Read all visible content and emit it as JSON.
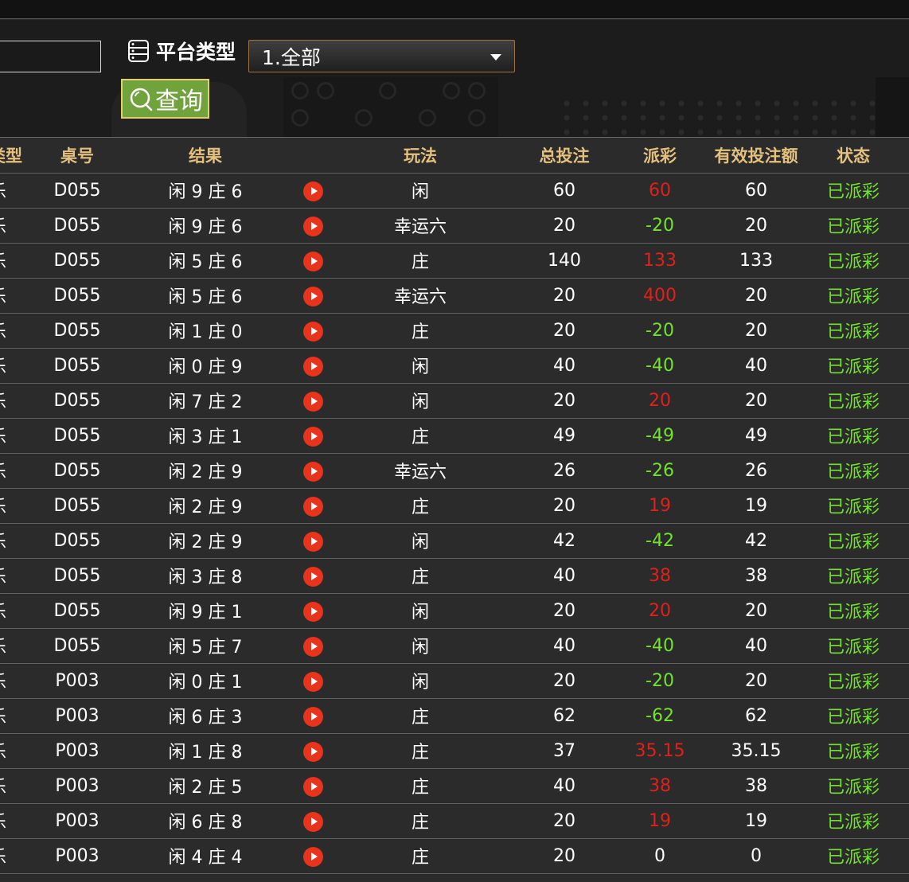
{
  "filter": {
    "platform_label": "平台类型",
    "platform_selected": "1.全部",
    "query_label": "查询"
  },
  "table": {
    "headers": {
      "type": "类型",
      "table_no": "桌号",
      "result": "结果",
      "play": "玩法",
      "total_bet": "总投注",
      "payout": "派彩",
      "valid_bet": "有效投注额",
      "status": "状态"
    },
    "rows": [
      {
        "type": "乐",
        "table_no": "D055",
        "result": "闲 9 庄 6",
        "play": "闲",
        "total_bet": "60",
        "payout": "60",
        "payout_color": "#e0201a",
        "valid_bet": "60",
        "status": "已派彩"
      },
      {
        "type": "乐",
        "table_no": "D055",
        "result": "闲 9 庄 6",
        "play": "幸运六",
        "total_bet": "20",
        "payout": "-20",
        "payout_color": "#72e32c",
        "valid_bet": "20",
        "status": "已派彩"
      },
      {
        "type": "乐",
        "table_no": "D055",
        "result": "闲 5 庄 6",
        "play": "庄",
        "total_bet": "140",
        "payout": "133",
        "payout_color": "#e0201a",
        "valid_bet": "133",
        "status": "已派彩"
      },
      {
        "type": "乐",
        "table_no": "D055",
        "result": "闲 5 庄 6",
        "play": "幸运六",
        "total_bet": "20",
        "payout": "400",
        "payout_color": "#e0201a",
        "valid_bet": "20",
        "status": "已派彩"
      },
      {
        "type": "乐",
        "table_no": "D055",
        "result": "闲 1 庄 0",
        "play": "庄",
        "total_bet": "20",
        "payout": "-20",
        "payout_color": "#72e32c",
        "valid_bet": "20",
        "status": "已派彩"
      },
      {
        "type": "乐",
        "table_no": "D055",
        "result": "闲 0 庄 9",
        "play": "闲",
        "total_bet": "40",
        "payout": "-40",
        "payout_color": "#72e32c",
        "valid_bet": "40",
        "status": "已派彩"
      },
      {
        "type": "乐",
        "table_no": "D055",
        "result": "闲 7 庄 2",
        "play": "闲",
        "total_bet": "20",
        "payout": "20",
        "payout_color": "#e0201a",
        "valid_bet": "20",
        "status": "已派彩"
      },
      {
        "type": "乐",
        "table_no": "D055",
        "result": "闲 3 庄 1",
        "play": "庄",
        "total_bet": "49",
        "payout": "-49",
        "payout_color": "#72e32c",
        "valid_bet": "49",
        "status": "已派彩"
      },
      {
        "type": "乐",
        "table_no": "D055",
        "result": "闲 2 庄 9",
        "play": "幸运六",
        "total_bet": "26",
        "payout": "-26",
        "payout_color": "#72e32c",
        "valid_bet": "26",
        "status": "已派彩"
      },
      {
        "type": "乐",
        "table_no": "D055",
        "result": "闲 2 庄 9",
        "play": "庄",
        "total_bet": "20",
        "payout": "19",
        "payout_color": "#e0201a",
        "valid_bet": "19",
        "status": "已派彩"
      },
      {
        "type": "乐",
        "table_no": "D055",
        "result": "闲 2 庄 9",
        "play": "闲",
        "total_bet": "42",
        "payout": "-42",
        "payout_color": "#72e32c",
        "valid_bet": "42",
        "status": "已派彩"
      },
      {
        "type": "乐",
        "table_no": "D055",
        "result": "闲 3 庄 8",
        "play": "庄",
        "total_bet": "40",
        "payout": "38",
        "payout_color": "#e0201a",
        "valid_bet": "38",
        "status": "已派彩"
      },
      {
        "type": "乐",
        "table_no": "D055",
        "result": "闲 9 庄 1",
        "play": "闲",
        "total_bet": "20",
        "payout": "20",
        "payout_color": "#e0201a",
        "valid_bet": "20",
        "status": "已派彩"
      },
      {
        "type": "乐",
        "table_no": "D055",
        "result": "闲 5 庄 7",
        "play": "闲",
        "total_bet": "40",
        "payout": "-40",
        "payout_color": "#72e32c",
        "valid_bet": "40",
        "status": "已派彩"
      },
      {
        "type": "乐",
        "table_no": "P003",
        "result": "闲 0 庄 1",
        "play": "闲",
        "total_bet": "20",
        "payout": "-20",
        "payout_color": "#72e32c",
        "valid_bet": "20",
        "status": "已派彩"
      },
      {
        "type": "乐",
        "table_no": "P003",
        "result": "闲 6 庄 3",
        "play": "庄",
        "total_bet": "62",
        "payout": "-62",
        "payout_color": "#72e32c",
        "valid_bet": "62",
        "status": "已派彩"
      },
      {
        "type": "乐",
        "table_no": "P003",
        "result": "闲 1 庄 8",
        "play": "庄",
        "total_bet": "37",
        "payout": "35.15",
        "payout_color": "#e0201a",
        "valid_bet": "35.15",
        "status": "已派彩"
      },
      {
        "type": "乐",
        "table_no": "P003",
        "result": "闲 2 庄 5",
        "play": "庄",
        "total_bet": "40",
        "payout": "38",
        "payout_color": "#e0201a",
        "valid_bet": "38",
        "status": "已派彩"
      },
      {
        "type": "乐",
        "table_no": "P003",
        "result": "闲 6 庄 8",
        "play": "庄",
        "total_bet": "20",
        "payout": "19",
        "payout_color": "#e0201a",
        "valid_bet": "19",
        "status": "已派彩"
      },
      {
        "type": "乐",
        "table_no": "P003",
        "result": "闲 4 庄 4",
        "play": "庄",
        "total_bet": "20",
        "payout": "0",
        "payout_color": "#ffffff",
        "valid_bet": "0",
        "status": "已派彩"
      }
    ]
  }
}
